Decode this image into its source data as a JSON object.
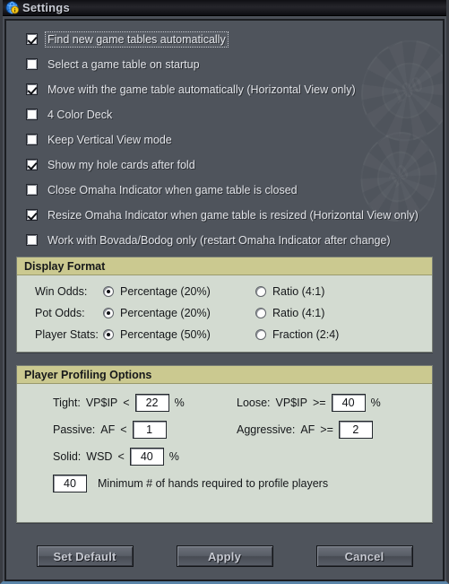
{
  "window": {
    "title": "Settings",
    "icon": "info-globe-icon"
  },
  "options": [
    {
      "label": "Find new game tables automatically",
      "checked": true,
      "focused": true
    },
    {
      "label": "Select a game table on startup",
      "checked": false,
      "focused": false
    },
    {
      "label": "Move with the game table automatically (Horizontal View only)",
      "checked": true,
      "focused": false
    },
    {
      "label": "4 Color Deck",
      "checked": false,
      "focused": false
    },
    {
      "label": "Keep Vertical View mode",
      "checked": false,
      "focused": false
    },
    {
      "label": "Show my hole cards after fold",
      "checked": true,
      "focused": false
    },
    {
      "label": "Close Omaha Indicator when game table is closed",
      "checked": false,
      "focused": false
    },
    {
      "label": "Resize Omaha Indicator when game table is resized (Horizontal View only)",
      "checked": true,
      "focused": false
    },
    {
      "label": "Work with Bovada/Bodog only (restart Omaha Indicator after change)",
      "checked": false,
      "focused": false
    }
  ],
  "display_format": {
    "title": "Display Format",
    "rows": [
      {
        "label": "Win Odds:",
        "option_a": "Percentage (20%)",
        "a_selected": true,
        "option_b": "Ratio (4:1)",
        "b_selected": false
      },
      {
        "label": "Pot Odds:",
        "option_a": "Percentage (20%)",
        "a_selected": true,
        "option_b": "Ratio (4:1)",
        "b_selected": false
      },
      {
        "label": "Player Stats:",
        "option_a": "Percentage (50%)",
        "a_selected": true,
        "option_b": "Fraction (2:4)",
        "b_selected": false
      }
    ]
  },
  "player_profiling": {
    "title": "Player Profiling Options",
    "tight": {
      "label": "Tight:",
      "stat": "VP$IP",
      "operator": "<",
      "value": "22",
      "unit": "%"
    },
    "loose": {
      "label": "Loose:",
      "stat": "VP$IP",
      "operator": ">=",
      "value": "40",
      "unit": "%"
    },
    "passive": {
      "label": "Passive:",
      "stat": "AF",
      "operator": "<",
      "value": "1",
      "unit": ""
    },
    "aggressive": {
      "label": "Aggressive:",
      "stat": "AF",
      "operator": ">=",
      "value": "2",
      "unit": ""
    },
    "solid": {
      "label": "Solid:",
      "stat": "WSD",
      "operator": "<",
      "value": "40",
      "unit": "%"
    },
    "min_hands": {
      "value": "40",
      "label": "Minimum # of hands required to profile players"
    }
  },
  "buttons": {
    "set_default": "Set Default",
    "apply": "Apply",
    "cancel": "Cancel"
  },
  "watermarks": {
    "chip_one_value": "100",
    "chip_two_value": "10"
  },
  "colors": {
    "window_bg": "#4f545c",
    "group_header": "#cbc990",
    "group_body": "#d3dbd1",
    "titlebar": "#101014"
  }
}
